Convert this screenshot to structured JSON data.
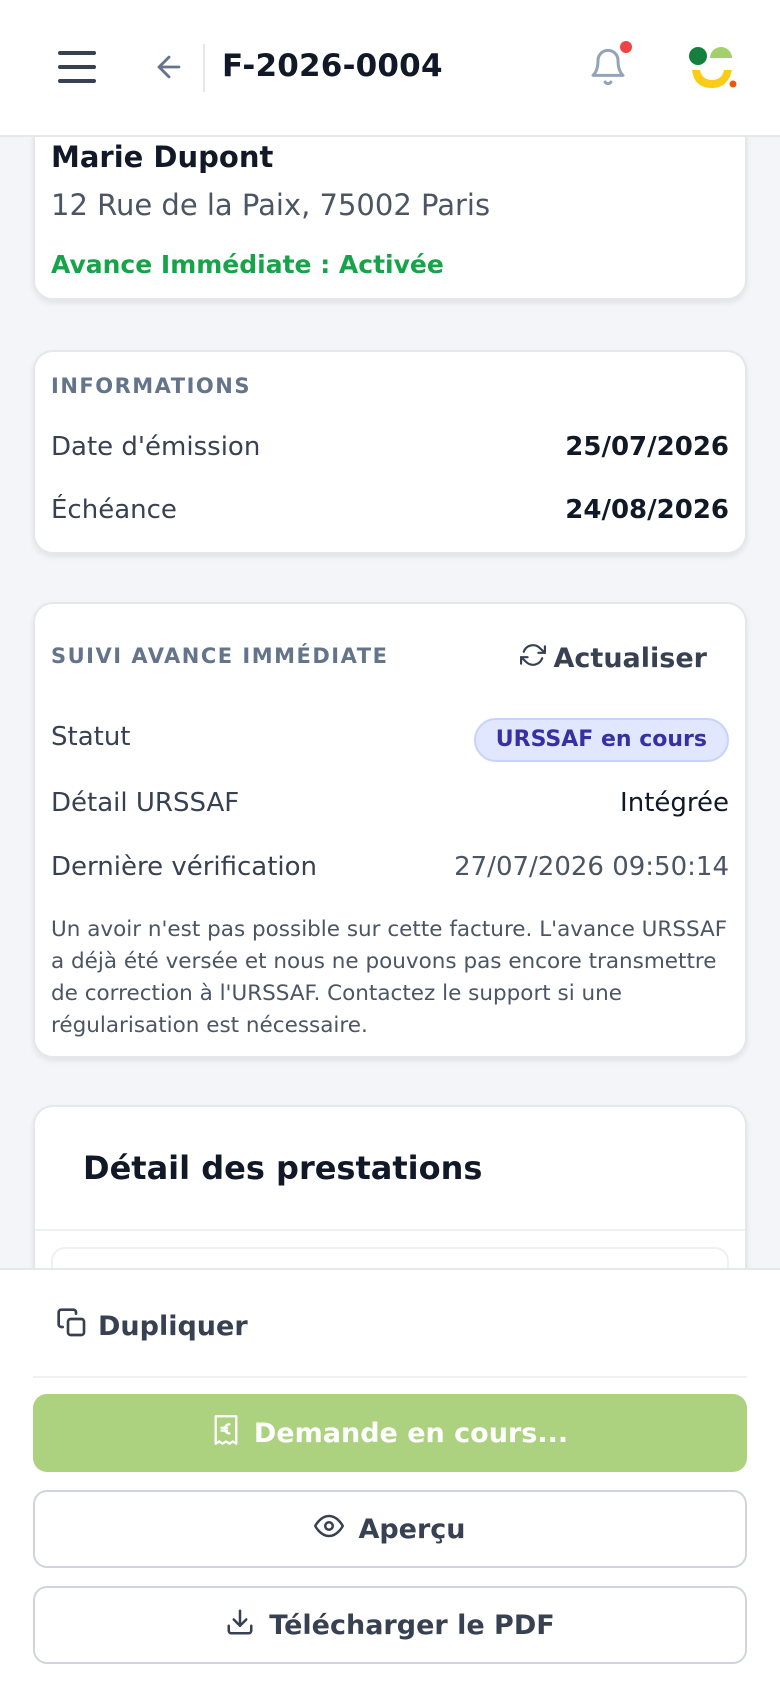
{
  "header": {
    "invoice_id": "F-2026-0004",
    "icons": [
      "menu-icon",
      "arrow-left-icon",
      "bell-icon",
      "app-logo"
    ],
    "notification_dot_color": "#ef4444"
  },
  "client": {
    "name": "Marie Dupont",
    "address": "12 Rue de la Paix, 75002 Paris",
    "avance_status": "Avance Immédiate : Activée"
  },
  "informations": {
    "title": "INFORMATIONS",
    "rows": [
      {
        "label": "Date d'émission",
        "value": "25/07/2026"
      },
      {
        "label": "Échéance",
        "value": "24/08/2026"
      }
    ]
  },
  "suivi": {
    "title": "SUIVI AVANCE IMMÉDIATE",
    "refresh_label": "Actualiser",
    "status_label": "Statut",
    "status_value": "URSSAF en cours",
    "detail_label": "Détail URSSAF",
    "detail_value": "Intégrée",
    "verification_label": "Dernière vérification",
    "verification_value": "27/07/2026 09:50:14",
    "note": "Un avoir n'est pas possible sur cette facture. L'avance URSSAF a déjà été versée et nous ne pouvons pas encore transmettre de correction à l'URSSAF. Contactez le support si une régularisation est nécessaire."
  },
  "prestations": {
    "title": "Détail des prestations"
  },
  "actions": {
    "duplicate_label": "Dupliquer",
    "primary_label": "Demande en cours...",
    "preview_label": "Aperçu",
    "download_label": "Télécharger le PDF"
  },
  "colors": {
    "accent_green": "#16a34a",
    "primary_button_disabled": "#acd27f",
    "badge_bg": "#e0e7ff",
    "badge_text": "#3730a3"
  }
}
